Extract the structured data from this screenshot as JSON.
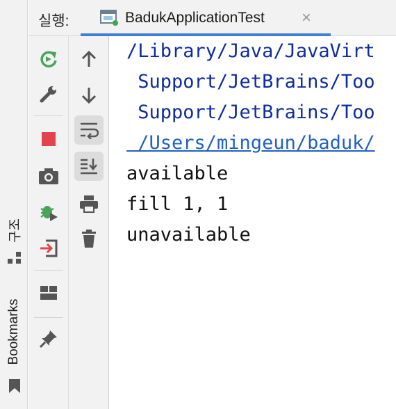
{
  "side_stripe": {
    "structure_label": "구조",
    "bookmarks_label": "Bookmarks"
  },
  "run_panel": {
    "run_label": "실행:",
    "tab": {
      "title": "BadukApplicationTest",
      "close_glyph": "×"
    }
  },
  "toolbar_left": {
    "items": [
      "rerun-icon",
      "wrench-icon",
      "stop-icon",
      "camera-icon",
      "debug-bug-icon",
      "exit-icon",
      "layout-icon",
      "pin-icon"
    ],
    "accent_green": "#4aa35a",
    "stop_red": "#e0454f"
  },
  "toolbar_right": {
    "items": [
      "arrow-up-icon",
      "arrow-down-icon",
      "soft-wrap-icon",
      "scroll-to-end-icon",
      "print-icon",
      "trash-icon"
    ]
  },
  "console": {
    "lines": [
      "/Library/Java/JavaVirt",
      " Support/JetBrains/Too",
      " Support/JetBrains/Too",
      " /Users/mingeun/baduk/",
      "available",
      "fill 1, 1",
      "unavailable"
    ]
  }
}
